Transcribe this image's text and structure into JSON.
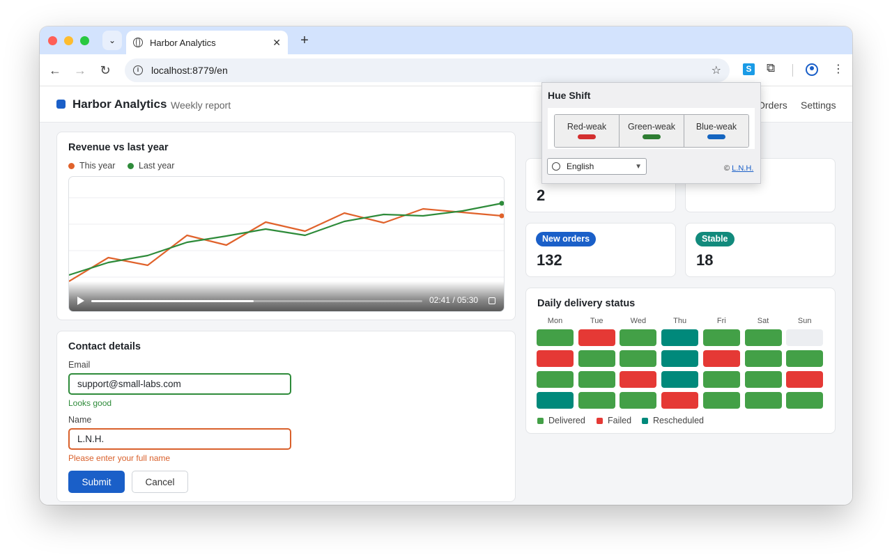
{
  "browser": {
    "tab_title": "Harbor Analytics",
    "url": "localhost:8779/en",
    "new_tab": "+",
    "close": "✕",
    "tab_search": "⌄",
    "ext_label": "S"
  },
  "header": {
    "brand": "Harbor Analytics",
    "subtitle": "Weekly report",
    "nav": [
      "Orders",
      "Settings"
    ]
  },
  "chart_data": {
    "type": "line",
    "title": "Revenue vs last year",
    "x": [
      0,
      1,
      2,
      3,
      4,
      5,
      6,
      7,
      8,
      9,
      10,
      11
    ],
    "series": [
      {
        "name": "This year",
        "color": "#e0622b",
        "values": [
          10,
          44,
          33,
          76,
          62,
          95,
          82,
          108,
          94,
          114,
          109,
          104
        ]
      },
      {
        "name": "Last year",
        "color": "#2e8b3a",
        "values": [
          19,
          37,
          47,
          66,
          75,
          85,
          76,
          96,
          106,
          104,
          111,
          122
        ]
      }
    ],
    "ylim": [
      0,
      150
    ],
    "grid": true,
    "legend": "top-left"
  },
  "video": {
    "time": "02:41 / 05:30",
    "progress": 0.49
  },
  "form": {
    "title": "Contact details",
    "email_label": "Email",
    "email_value": "support@small-labs.com",
    "email_hint": "Looks good",
    "name_label": "Name",
    "name_value": "L.N.H.",
    "name_error": "Please enter your full name",
    "submit": "Submit",
    "cancel": "Cancel"
  },
  "stats": [
    {
      "badge": "",
      "value": "2",
      "color": "#2e8b3a"
    },
    {
      "badge": "",
      "value": "",
      "color": ""
    },
    {
      "badge": "New orders",
      "value": "132",
      "color": "#1a5fc8"
    },
    {
      "badge": "Stable",
      "value": "18",
      "color": "#128a7c"
    }
  ],
  "delivery": {
    "title": "Daily delivery status",
    "days": [
      "Mon",
      "Tue",
      "Wed",
      "Thu",
      "Fri",
      "Sat",
      "Sun"
    ],
    "grid": [
      [
        "delivered",
        "failed",
        "delivered",
        "rescheduled",
        "delivered",
        "delivered",
        "empty"
      ],
      [
        "failed",
        "delivered",
        "delivered",
        "rescheduled",
        "failed",
        "delivered",
        "delivered"
      ],
      [
        "delivered",
        "delivered",
        "failed",
        "rescheduled",
        "delivered",
        "delivered",
        "failed"
      ],
      [
        "rescheduled",
        "delivered",
        "delivered",
        "failed",
        "delivered",
        "delivered",
        "delivered"
      ]
    ],
    "legend": [
      {
        "label": "Delivered",
        "color": "#43a047"
      },
      {
        "label": "Failed",
        "color": "#e53935"
      },
      {
        "label": "Rescheduled",
        "color": "#00897b"
      }
    ]
  },
  "popup": {
    "title": "Hue Shift",
    "modes": [
      {
        "label": "Red-weak",
        "color": "#d32f2f"
      },
      {
        "label": "Green-weak",
        "color": "#2e7d32"
      },
      {
        "label": "Blue-weak",
        "color": "#1565c0"
      }
    ],
    "language": "English",
    "credit_prefix": "©",
    "credit_link": "L.N.H."
  }
}
